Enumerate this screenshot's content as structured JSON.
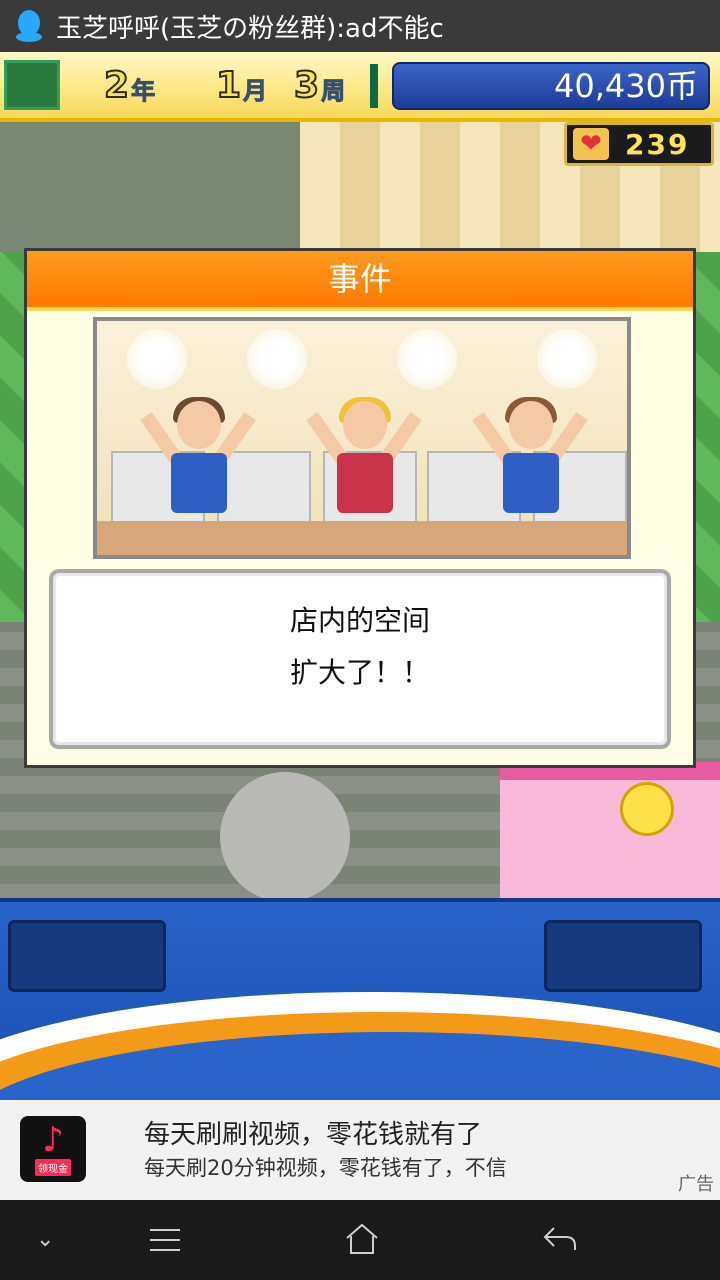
{
  "notification": {
    "icon": "qq-penguin-icon",
    "text": "玉芝呼呼(玉芝の粉丝群):ad不能c"
  },
  "hud": {
    "year_num": "2",
    "year_unit": "年",
    "month_num": "1",
    "month_unit": "月",
    "week_num": "3",
    "week_unit": "周",
    "money": "40,430币",
    "hearts": "239"
  },
  "event": {
    "title": "事件",
    "line1": "店内的空间",
    "line2": "扩大了！！"
  },
  "ad": {
    "app_icon": "douyin-icon",
    "app_tag": "领现金",
    "headline": "每天刷刷视频，零花钱就有了",
    "subline": "每天刷20分钟视频，零花钱有了，不信",
    "mark": "广告"
  },
  "colors": {
    "dialog_header": "#ff8a0a",
    "money_panel": "#2a52b8",
    "bottom_panel": "#2a63c9"
  }
}
